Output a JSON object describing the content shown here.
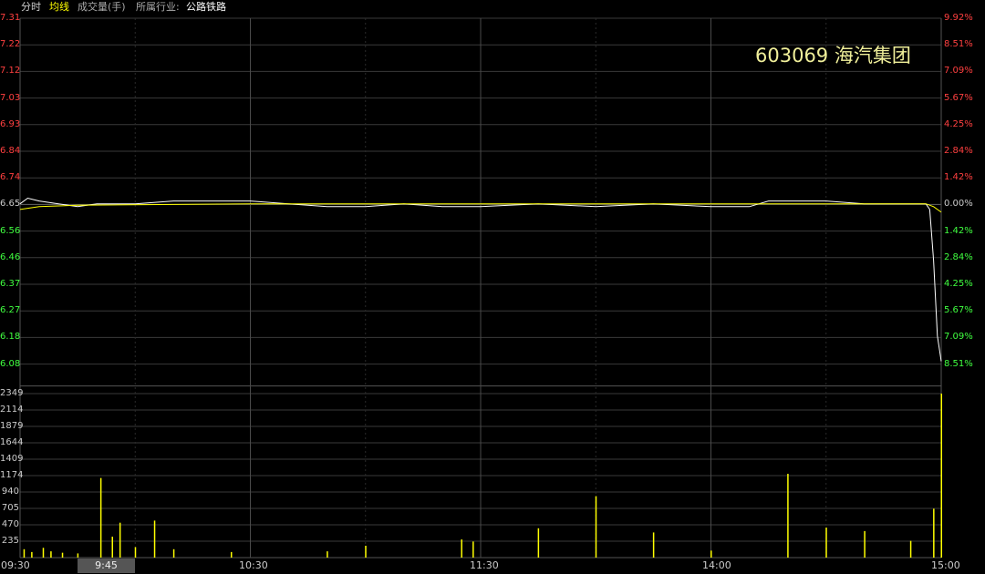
{
  "tabs": [
    {
      "label": "分时",
      "color": "#cccccc"
    },
    {
      "label": "均线",
      "color": "#ffff00"
    },
    {
      "label": "成交量(手)",
      "color": "#aaaaaa"
    },
    {
      "label": "所属行业:",
      "color": "#aaaaaa"
    },
    {
      "label": "公路铁路",
      "color": "#ffffff"
    }
  ],
  "stock_title": "603069 海汽集团",
  "price_axis": [
    "7.31",
    "7.22",
    "7.12",
    "7.03",
    "6.93",
    "6.84",
    "6.74",
    "6.65",
    "6.56",
    "6.46",
    "6.37",
    "6.27",
    "6.18",
    "6.08"
  ],
  "pct_axis": [
    "9.92%",
    "8.51%",
    "7.09%",
    "5.67%",
    "4.25%",
    "2.84%",
    "1.42%",
    "0.00%",
    "1.42%",
    "2.84%",
    "4.25%",
    "5.67%",
    "7.09%",
    "8.51%"
  ],
  "volume_axis": [
    "2349",
    "2114",
    "1879",
    "1644",
    "1409",
    "1174",
    "940",
    "705",
    "470",
    "235"
  ],
  "time_labels": [
    "09:30",
    "10:30",
    "11:30",
    "14:00",
    "15:00"
  ],
  "cursor_time": "9:45",
  "colors": {
    "up": "#ff4040",
    "down": "#40ff40",
    "neutral": "#cccccc",
    "price_line": "#ffffff",
    "avg_line": "#ffff00",
    "volume": "#ffff00",
    "grid": "#3a3a3a"
  },
  "chart_data": {
    "type": "line",
    "prev_close": 6.65,
    "ylim": [
      6.08,
      7.31
    ],
    "volume_max": 2349,
    "price_series": [
      {
        "t": "09:30",
        "v": 6.65
      },
      {
        "t": "09:32",
        "v": 6.67
      },
      {
        "t": "09:35",
        "v": 6.66
      },
      {
        "t": "09:40",
        "v": 6.65
      },
      {
        "t": "09:45",
        "v": 6.64
      },
      {
        "t": "09:50",
        "v": 6.65
      },
      {
        "t": "10:00",
        "v": 6.65
      },
      {
        "t": "10:10",
        "v": 6.66
      },
      {
        "t": "10:20",
        "v": 6.66
      },
      {
        "t": "10:30",
        "v": 6.66
      },
      {
        "t": "10:40",
        "v": 6.65
      },
      {
        "t": "10:50",
        "v": 6.64
      },
      {
        "t": "11:00",
        "v": 6.64
      },
      {
        "t": "11:10",
        "v": 6.65
      },
      {
        "t": "11:20",
        "v": 6.64
      },
      {
        "t": "11:30",
        "v": 6.64
      },
      {
        "t": "13:15",
        "v": 6.65
      },
      {
        "t": "13:30",
        "v": 6.64
      },
      {
        "t": "13:45",
        "v": 6.65
      },
      {
        "t": "14:00",
        "v": 6.64
      },
      {
        "t": "14:10",
        "v": 6.64
      },
      {
        "t": "14:15",
        "v": 6.66
      },
      {
        "t": "14:30",
        "v": 6.66
      },
      {
        "t": "14:40",
        "v": 6.65
      },
      {
        "t": "14:50",
        "v": 6.65
      },
      {
        "t": "14:56",
        "v": 6.65
      },
      {
        "t": "14:57",
        "v": 6.63
      },
      {
        "t": "14:58",
        "v": 6.45
      },
      {
        "t": "14:59",
        "v": 6.18
      },
      {
        "t": "15:00",
        "v": 6.09
      }
    ],
    "avg_series": [
      {
        "t": "09:30",
        "v": 6.63
      },
      {
        "t": "09:35",
        "v": 6.64
      },
      {
        "t": "09:45",
        "v": 6.645
      },
      {
        "t": "10:30",
        "v": 6.65
      },
      {
        "t": "11:30",
        "v": 6.65
      },
      {
        "t": "14:00",
        "v": 6.65
      },
      {
        "t": "14:56",
        "v": 6.65
      },
      {
        "t": "14:58",
        "v": 6.64
      },
      {
        "t": "15:00",
        "v": 6.62
      }
    ],
    "volume": [
      {
        "t": "09:31",
        "v": 120
      },
      {
        "t": "09:33",
        "v": 80
      },
      {
        "t": "09:36",
        "v": 140
      },
      {
        "t": "09:38",
        "v": 90
      },
      {
        "t": "09:41",
        "v": 70
      },
      {
        "t": "09:45",
        "v": 60
      },
      {
        "t": "09:51",
        "v": 1140
      },
      {
        "t": "09:54",
        "v": 300
      },
      {
        "t": "09:56",
        "v": 500
      },
      {
        "t": "10:00",
        "v": 150
      },
      {
        "t": "10:05",
        "v": 530
      },
      {
        "t": "10:10",
        "v": 120
      },
      {
        "t": "10:25",
        "v": 80
      },
      {
        "t": "10:50",
        "v": 90
      },
      {
        "t": "11:00",
        "v": 170
      },
      {
        "t": "11:25",
        "v": 260
      },
      {
        "t": "11:28",
        "v": 230
      },
      {
        "t": "13:15",
        "v": 420
      },
      {
        "t": "13:30",
        "v": 880
      },
      {
        "t": "13:45",
        "v": 360
      },
      {
        "t": "14:00",
        "v": 100
      },
      {
        "t": "14:20",
        "v": 1200
      },
      {
        "t": "14:30",
        "v": 430
      },
      {
        "t": "14:40",
        "v": 380
      },
      {
        "t": "14:52",
        "v": 240
      },
      {
        "t": "14:58",
        "v": 700
      },
      {
        "t": "15:00",
        "v": 2349
      }
    ]
  }
}
